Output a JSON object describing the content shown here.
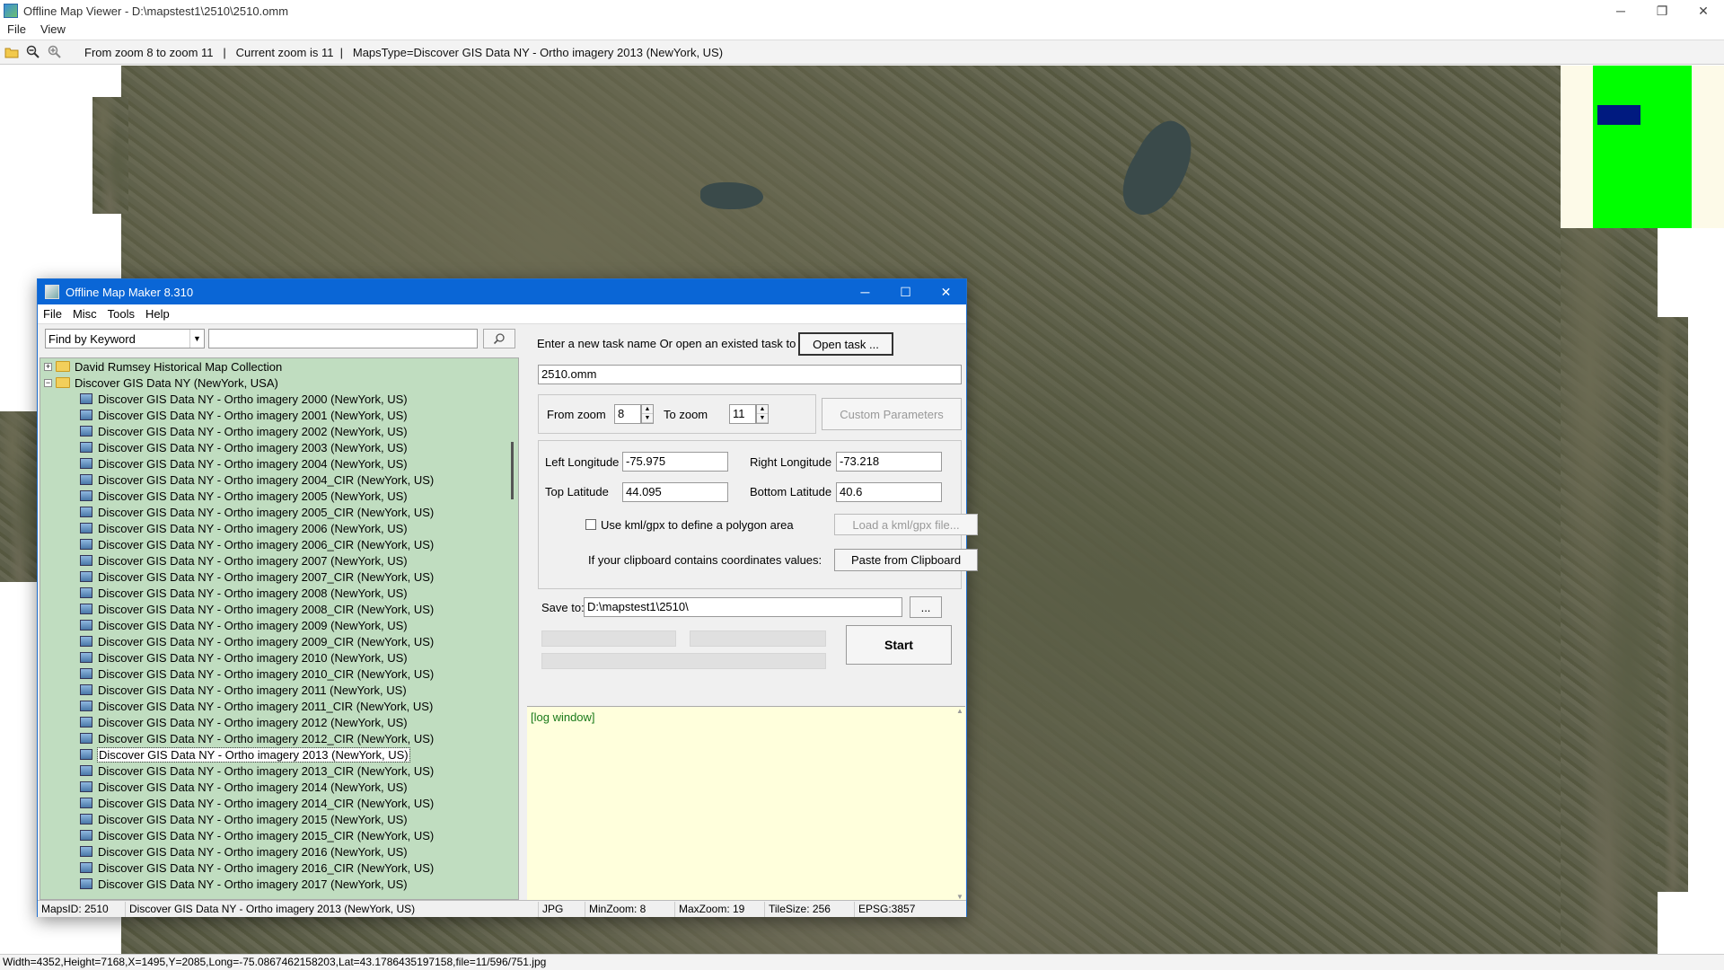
{
  "window": {
    "title": "Offline Map Viewer - D:\\mapstest1\\2510\\2510.omm",
    "controls": [
      "─",
      "❐",
      "✕"
    ]
  },
  "menu": [
    "File",
    "View"
  ],
  "toolbar": {
    "status_text": "From zoom 8 to zoom 11   |   Current zoom is 11  |   MapsType=Discover GIS Data NY - Ortho imagery 2013 (NewYork, US)"
  },
  "statusbar": {
    "text": "Width=4352,Height=7168,X=1495,Y=2085,Long=-75.0867462158203,Lat=43.1786435197158,file=11/596/751.jpg"
  },
  "dialog": {
    "title": "Offline Map Maker 8.310",
    "controls": [
      "─",
      "☐",
      "✕"
    ],
    "menu": [
      "File",
      "Misc",
      "Tools",
      "Help"
    ],
    "find": {
      "mode": "Find by Keyword",
      "query": ""
    },
    "tree": {
      "roots": [
        {
          "label": "David Rumsey Historical Map Collection",
          "expander": "+"
        },
        {
          "label": "Discover GIS Data NY (NewYork, USA)",
          "expander": "−"
        }
      ],
      "items": [
        "Discover GIS Data NY - Ortho imagery 2000 (NewYork, US)",
        "Discover GIS Data NY - Ortho imagery 2001 (NewYork, US)",
        "Discover GIS Data NY - Ortho imagery 2002 (NewYork, US)",
        "Discover GIS Data NY - Ortho imagery 2003 (NewYork, US)",
        "Discover GIS Data NY - Ortho imagery 2004 (NewYork, US)",
        "Discover GIS Data NY - Ortho imagery 2004_CIR (NewYork, US)",
        "Discover GIS Data NY - Ortho imagery 2005 (NewYork, US)",
        "Discover GIS Data NY - Ortho imagery 2005_CIR (NewYork, US)",
        "Discover GIS Data NY - Ortho imagery 2006 (NewYork, US)",
        "Discover GIS Data NY - Ortho imagery 2006_CIR (NewYork, US)",
        "Discover GIS Data NY - Ortho imagery 2007 (NewYork, US)",
        "Discover GIS Data NY - Ortho imagery 2007_CIR (NewYork, US)",
        "Discover GIS Data NY - Ortho imagery 2008 (NewYork, US)",
        "Discover GIS Data NY - Ortho imagery 2008_CIR (NewYork, US)",
        "Discover GIS Data NY - Ortho imagery 2009 (NewYork, US)",
        "Discover GIS Data NY - Ortho imagery 2009_CIR (NewYork, US)",
        "Discover GIS Data NY - Ortho imagery 2010 (NewYork, US)",
        "Discover GIS Data NY - Ortho imagery 2010_CIR (NewYork, US)",
        "Discover GIS Data NY - Ortho imagery 2011 (NewYork, US)",
        "Discover GIS Data NY - Ortho imagery 2011_CIR (NewYork, US)",
        "Discover GIS Data NY - Ortho imagery 2012 (NewYork, US)",
        "Discover GIS Data NY - Ortho imagery 2012_CIR (NewYork, US)",
        "Discover GIS Data NY - Ortho imagery 2013 (NewYork, US)",
        "Discover GIS Data NY - Ortho imagery 2013_CIR (NewYork, US)",
        "Discover GIS Data NY - Ortho imagery 2014 (NewYork, US)",
        "Discover GIS Data NY - Ortho imagery 2014_CIR (NewYork, US)",
        "Discover GIS Data NY - Ortho imagery 2015 (NewYork, US)",
        "Discover GIS Data NY - Ortho imagery 2015_CIR (NewYork, US)",
        "Discover GIS Data NY - Ortho imagery 2016 (NewYork, US)",
        "Discover GIS Data NY - Ortho imagery 2016_CIR (NewYork, US)",
        "Discover GIS Data NY - Ortho imagery 2017 (NewYork, US)"
      ],
      "selected_index": 22
    },
    "task": {
      "prompt": "Enter a new task name Or open an existed task to continue:",
      "open_btn": "Open task ...",
      "name": "2510.omm"
    },
    "zoom": {
      "from_label": "From zoom",
      "from_value": "8",
      "to_label": "To zoom",
      "to_value": "11",
      "custom_btn": "Custom Parameters"
    },
    "coords": {
      "left_lon_label": "Left Longitude",
      "left_lon": "-75.975",
      "right_lon_label": "Right Longitude",
      "right_lon": "-73.218",
      "top_lat_label": "Top Latitude",
      "top_lat": "44.095",
      "bottom_lat_label": "Bottom Latitude",
      "bottom_lat": "40.6",
      "kml_label": "Use kml/gpx to define a polygon area",
      "kml_btn": "Load a kml/gpx file...",
      "clip_label": "If your clipboard contains coordinates values:",
      "clip_btn": "Paste from Clipboard"
    },
    "save": {
      "label": "Save to:",
      "path": "D:\\mapstest1\\2510\\",
      "browse": "..."
    },
    "start_btn": "Start",
    "log_text": "[log window]",
    "status": {
      "maps_id": "MapsID: 2510",
      "name": "Discover GIS Data NY - Ortho imagery 2013 (NewYork, US)",
      "format": "JPG",
      "min_zoom": "MinZoom: 8",
      "max_zoom": "MaxZoom: 19",
      "tile_size": "TileSize: 256",
      "epsg": "EPSG:3857"
    }
  }
}
